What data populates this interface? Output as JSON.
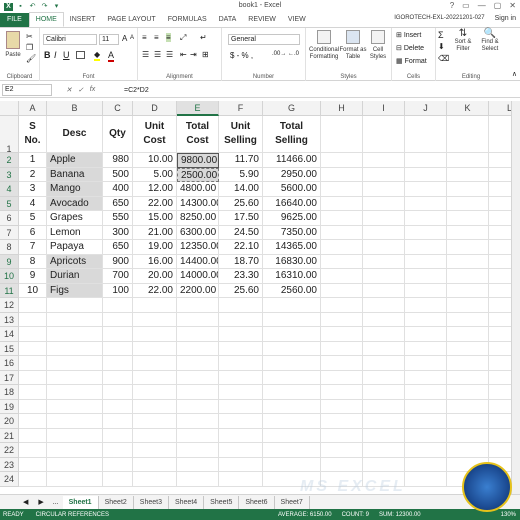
{
  "window": {
    "title": "book1 - Excel",
    "account": "IGOROTECH-EXL-20221201-027",
    "signin": "Sign in"
  },
  "tabs": [
    "FILE",
    "HOME",
    "INSERT",
    "PAGE LAYOUT",
    "FORMULAS",
    "DATA",
    "REVIEW",
    "VIEW"
  ],
  "active_tab": "HOME",
  "ribbon": {
    "clipboard": {
      "label": "Clipboard",
      "paste": "Paste"
    },
    "font": {
      "label": "Font",
      "name": "Calibri",
      "size": "11"
    },
    "alignment": {
      "label": "Alignment"
    },
    "number": {
      "label": "Number",
      "format": "General",
      "symbols": "$ - % ,"
    },
    "styles": {
      "label": "Styles",
      "conditional": "Conditional Formatting",
      "format_table": "Format as Table",
      "cell_styles": "Cell Styles"
    },
    "cells": {
      "label": "Cells",
      "insert": "Insert",
      "delete": "Delete",
      "format": "Format"
    },
    "editing": {
      "label": "Editing",
      "sort": "Sort & Filter",
      "find": "Find & Select"
    }
  },
  "formula_bar": {
    "name_box": "E2",
    "formula": "=C2*D2"
  },
  "columns": [
    "A",
    "B",
    "C",
    "D",
    "E",
    "F",
    "G",
    "H",
    "I",
    "J",
    "K",
    "L",
    "M"
  ],
  "selected_column": "E",
  "headers": {
    "a": "S No.",
    "b": "Desc",
    "c": "Qty",
    "d": "Unit Cost",
    "e": "Total Cost",
    "f": "Unit Selling",
    "g": "Total Selling"
  },
  "rows": [
    {
      "sno": "1",
      "desc": "Apple",
      "qty": "980",
      "uc": "10.00",
      "tc": "9800.00",
      "us": "11.70",
      "ts": "11466.00"
    },
    {
      "sno": "2",
      "desc": "Banana",
      "qty": "500",
      "uc": "5.00",
      "tc": "2500.00",
      "us": "5.90",
      "ts": "2950.00"
    },
    {
      "sno": "3",
      "desc": "Mango",
      "qty": "400",
      "uc": "12.00",
      "tc": "4800.00",
      "us": "14.00",
      "ts": "5600.00"
    },
    {
      "sno": "4",
      "desc": "Avocado",
      "qty": "650",
      "uc": "22.00",
      "tc": "14300.00",
      "us": "25.60",
      "ts": "16640.00"
    },
    {
      "sno": "5",
      "desc": "Grapes",
      "qty": "550",
      "uc": "15.00",
      "tc": "8250.00",
      "us": "17.50",
      "ts": "9625.00"
    },
    {
      "sno": "6",
      "desc": "Lemon",
      "qty": "300",
      "uc": "21.00",
      "tc": "6300.00",
      "us": "24.50",
      "ts": "7350.00"
    },
    {
      "sno": "7",
      "desc": "Papaya",
      "qty": "650",
      "uc": "19.00",
      "tc": "12350.00",
      "us": "22.10",
      "ts": "14365.00"
    },
    {
      "sno": "8",
      "desc": "Apricots",
      "qty": "900",
      "uc": "16.00",
      "tc": "14400.00",
      "us": "18.70",
      "ts": "16830.00"
    },
    {
      "sno": "9",
      "desc": "Durian",
      "qty": "700",
      "uc": "20.00",
      "tc": "14000.00",
      "us": "23.30",
      "ts": "16310.00"
    },
    {
      "sno": "10",
      "desc": "Figs",
      "qty": "100",
      "uc": "22.00",
      "tc": "2200.00",
      "us": "25.60",
      "ts": "2560.00"
    }
  ],
  "row_numbers": [
    "1",
    "2",
    "3",
    "4",
    "5",
    "6",
    "7",
    "8",
    "9",
    "10",
    "11",
    "12",
    "13",
    "14",
    "15",
    "16",
    "17",
    "18",
    "19",
    "20",
    "21",
    "22",
    "23",
    "24"
  ],
  "sheets": [
    "Sheet1",
    "Sheet2",
    "Sheet3",
    "Sheet4",
    "Sheet5",
    "Sheet6",
    "Sheet7"
  ],
  "status": {
    "ready": "READY",
    "circular": "CIRCULAR REFERENCES",
    "average": "AVERAGE: 6150.00",
    "count": "COUNT: 9",
    "sum": "SUM: 12300.00",
    "zoom": "130%"
  },
  "logo_text": "IGOROTECH",
  "watermark": "MS EXCEL",
  "colors": {
    "excel_green": "#217346",
    "highlight": "#d9d9d9"
  }
}
